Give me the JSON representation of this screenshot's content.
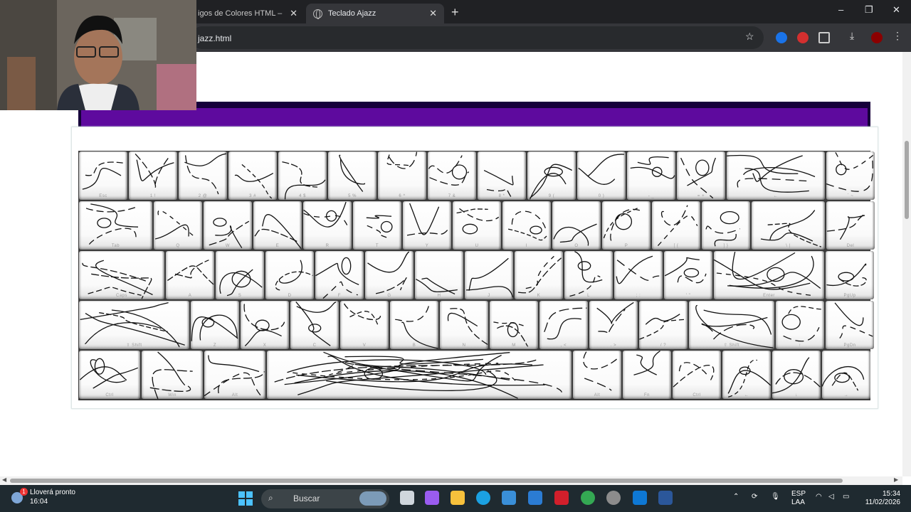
{
  "browser": {
    "tabs": [
      {
        "label": "igos de Colores HTML – HT",
        "active": false
      },
      {
        "label": "Teclado Ajazz",
        "active": true
      }
    ],
    "new_tab_symbol": "+",
    "url": "jazz.html",
    "window_controls": {
      "minimize": "–",
      "maximize": "❐",
      "close": "✕"
    }
  },
  "keyboard": {
    "colors": {
      "trim": "#5e0a9e",
      "trim_dark": "#16003a",
      "keycap": "#ffffff",
      "line": "#111111"
    },
    "rows": [
      {
        "keys": [
          {
            "w": 70,
            "legend": "Esc"
          },
          {
            "w": 70,
            "legend": "1 !"
          },
          {
            "w": 70,
            "legend": "2 @"
          },
          {
            "w": 70,
            "legend": "3 #"
          },
          {
            "w": 70,
            "legend": "4 $"
          },
          {
            "w": 70,
            "legend": "5 %"
          },
          {
            "w": 70,
            "legend": "6 ^"
          },
          {
            "w": 70,
            "legend": "7 &"
          },
          {
            "w": 70,
            "legend": "8 *"
          },
          {
            "w": 70,
            "legend": "9 ("
          },
          {
            "w": 70,
            "legend": "0 )"
          },
          {
            "w": 70,
            "legend": "- _"
          },
          {
            "w": 70,
            "legend": "= +"
          },
          {
            "w": 140,
            "legend": "←"
          },
          {
            "w": 70,
            "legend": "` ~"
          }
        ]
      },
      {
        "keys": [
          {
            "w": 105,
            "legend": "Tab"
          },
          {
            "w": 70,
            "legend": "Q"
          },
          {
            "w": 70,
            "legend": "W"
          },
          {
            "w": 70,
            "legend": "E"
          },
          {
            "w": 70,
            "legend": "R"
          },
          {
            "w": 70,
            "legend": "T"
          },
          {
            "w": 70,
            "legend": "Y"
          },
          {
            "w": 70,
            "legend": "U"
          },
          {
            "w": 70,
            "legend": "I"
          },
          {
            "w": 70,
            "legend": "O"
          },
          {
            "w": 70,
            "legend": "P"
          },
          {
            "w": 70,
            "legend": "[ {"
          },
          {
            "w": 70,
            "legend": "] }"
          },
          {
            "w": 105,
            "legend": "\\ |"
          },
          {
            "w": 70,
            "legend": "Del"
          }
        ]
      },
      {
        "keys": [
          {
            "w": 122,
            "legend": "Caps"
          },
          {
            "w": 70,
            "legend": "A"
          },
          {
            "w": 70,
            "legend": "S"
          },
          {
            "w": 70,
            "legend": "D"
          },
          {
            "w": 70,
            "legend": "F"
          },
          {
            "w": 70,
            "legend": "G"
          },
          {
            "w": 70,
            "legend": "H"
          },
          {
            "w": 70,
            "legend": "J"
          },
          {
            "w": 70,
            "legend": "K"
          },
          {
            "w": 70,
            "legend": "L"
          },
          {
            "w": 70,
            "legend": "; :"
          },
          {
            "w": 70,
            "legend": "' \""
          },
          {
            "w": 157,
            "legend": "Enter"
          },
          {
            "w": 70,
            "legend": "PgUp"
          }
        ]
      },
      {
        "keys": [
          {
            "w": 157,
            "legend": "⇧ Shift"
          },
          {
            "w": 70,
            "legend": "Z"
          },
          {
            "w": 70,
            "legend": "X"
          },
          {
            "w": 70,
            "legend": "C"
          },
          {
            "w": 70,
            "legend": "V"
          },
          {
            "w": 70,
            "legend": "B"
          },
          {
            "w": 70,
            "legend": "N"
          },
          {
            "w": 70,
            "legend": "M"
          },
          {
            "w": 70,
            "legend": ", <"
          },
          {
            "w": 70,
            "legend": ". >"
          },
          {
            "w": 70,
            "legend": "/ ?"
          },
          {
            "w": 122,
            "legend": "⇧ Shift"
          },
          {
            "w": 70,
            "legend": "↑"
          },
          {
            "w": 70,
            "legend": "PgDn"
          }
        ]
      },
      {
        "keys": [
          {
            "w": 88,
            "legend": "Ctrl"
          },
          {
            "w": 88,
            "legend": "Win"
          },
          {
            "w": 88,
            "legend": "Alt"
          },
          {
            "w": 430,
            "legend": ""
          },
          {
            "w": 70,
            "legend": "Alt"
          },
          {
            "w": 70,
            "legend": "Fn"
          },
          {
            "w": 70,
            "legend": "Ctrl"
          },
          {
            "w": 70,
            "legend": "←"
          },
          {
            "w": 70,
            "legend": "↓"
          },
          {
            "w": 70,
            "legend": "→"
          }
        ]
      }
    ]
  },
  "taskbar": {
    "weather_title": "Lloverá pronto",
    "weather_time": "16:04",
    "weather_badge": "1",
    "search_placeholder": "Buscar",
    "language_top": "ESP",
    "language_bottom": "LAA",
    "clock_time": "15:34",
    "clock_date": "11/02/2026"
  }
}
